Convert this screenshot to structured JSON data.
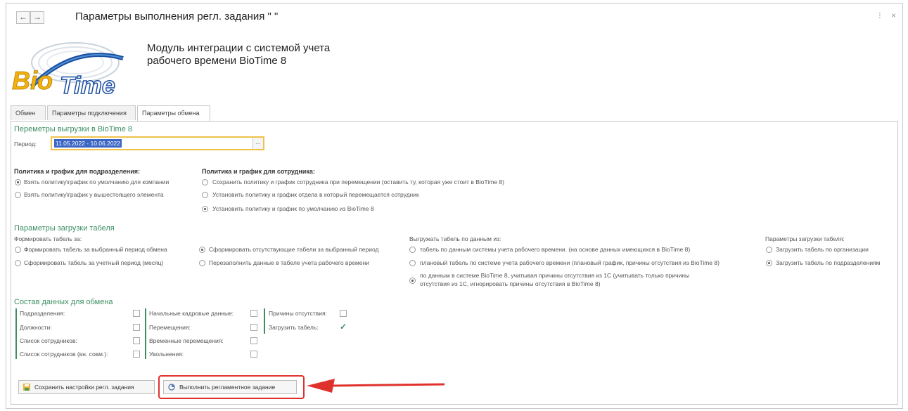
{
  "window": {
    "title": "Параметры выполнения регл. задания \"  \"",
    "back": "←",
    "forward": "→",
    "more": "⁝",
    "close": "×"
  },
  "logo": {
    "text_bio": "Bio",
    "text_time": "Time"
  },
  "module": {
    "line1": "Модуль интеграции с системой учета",
    "line2": "рабочего времени  BioTime 8"
  },
  "tabs": [
    "Обмен",
    "Параметры подключения",
    "Параметры обмена"
  ],
  "export": {
    "title": "Переметры выгрузки в BioTime 8",
    "period_label": "Период:",
    "period_value": "11.05.2022 - 10.06.2022",
    "period_btn": "...",
    "dept_title": "Политика и график для подразделения:",
    "dept_options": [
      "Взять политику\\график по умолчанию для компании",
      "Взять политику\\график у вышестоящего элемента"
    ],
    "emp_title": "Политика и график для сотрудника:",
    "emp_options": [
      "Сохранить политику и график сотрудника при перемещении (оставить ту, которая уже стоит в BioTime 8)",
      "Установить политику и график отдела в который перемещается сотрудник",
      "Установить политику и график по умолчанию из BioTime 8"
    ]
  },
  "timesheet": {
    "title": "Параметры загрузки табеля",
    "form_label": "Формировать табель за:",
    "form_options": [
      "Формировать табель за выбранный период обмена",
      "Сформировать табель за учетный период (месяц)"
    ],
    "missing_options": [
      "Сформировать отсутствующие табели за выбранный  период",
      "Перезаполнить данные в табеле учета рабочего времени"
    ],
    "upload_label": "Выгружать табель по данным из:",
    "upload_options": [
      "табель по данным системы учета рабочего времени. (на основе данных имеющихся в BioTime 8)",
      "плановый табель по системе учета рабочего времени (плановый график, причины отсутствия из BioTime 8)",
      "по данным в системе BioTime 8, учитывая причины отсутствия из 1С (учитывать только причины",
      "отсутствия из 1С, игнорировать причины отсутствия в BioTime 8)"
    ],
    "load_label": "Параметры загрузки табеля:",
    "load_options": [
      "Загрузить табель по организации",
      "Загрузить табель по подразделениям"
    ]
  },
  "composition": {
    "title": "Состав данных для обмена",
    "col1": [
      "Подразделения:",
      "Должности:",
      "Список сотрудников:",
      "Список сотрудников (вн. совм.):"
    ],
    "col2": [
      "Начальные кадровые данные:",
      "Перемещения:",
      "Временные перемещения:",
      "Увольнения:"
    ],
    "col3": [
      "Причины отсутствия:",
      "Загрузить табель:"
    ],
    "checkmark": "✓"
  },
  "buttons": {
    "save": "Сохранить настройки регл. задания",
    "run": "Выполнить регламентное задание"
  }
}
